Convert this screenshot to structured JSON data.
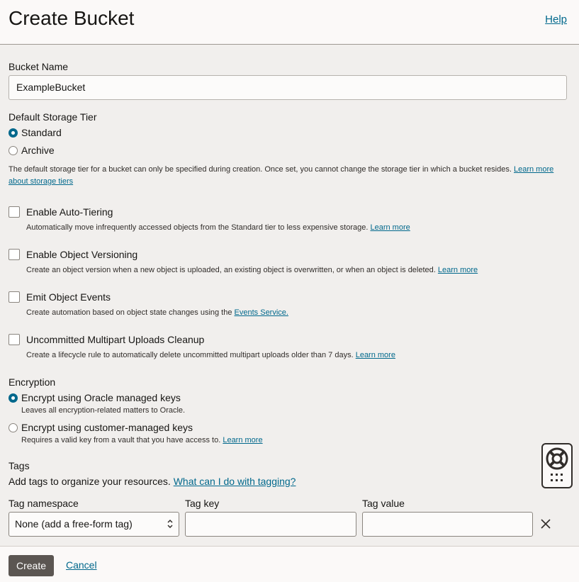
{
  "header": {
    "title": "Create Bucket",
    "help_link": "Help"
  },
  "bucket_name": {
    "label": "Bucket Name",
    "value": "ExampleBucket"
  },
  "storage_tier": {
    "label": "Default Storage Tier",
    "options": [
      "Standard",
      "Archive"
    ],
    "selected": "Standard",
    "help_text": "The default storage tier for a bucket can only be specified during creation. Once set, you cannot change the storage tier in which a bucket resides.",
    "learn_more": "Learn more about storage tiers",
    "learn_more_line1": "Learn more",
    "learn_more_line2": "about storage tiers"
  },
  "options": [
    {
      "label": "Enable Auto-Tiering",
      "description": "Automatically move infrequently accessed objects from the Standard tier to less expensive storage.",
      "link": "Learn more",
      "checked": false
    },
    {
      "label": "Enable Object Versioning",
      "description": "Create an object version when a new object is uploaded, an existing object is overwritten, or when an object is deleted.",
      "link": "Learn more",
      "checked": false
    },
    {
      "label": "Emit Object Events",
      "description": "Create automation based on object state changes using the",
      "link": "Events Service.",
      "checked": false
    },
    {
      "label": "Uncommitted Multipart Uploads Cleanup",
      "description": "Create a lifecycle rule to automatically delete uncommitted multipart uploads older than 7 days.",
      "link": "Learn more",
      "checked": false
    }
  ],
  "encryption": {
    "label": "Encryption",
    "options": [
      {
        "label": "Encrypt using Oracle managed keys",
        "description": "Leaves all encryption-related matters to Oracle.",
        "link": ""
      },
      {
        "label": "Encrypt using customer-managed keys",
        "description": "Requires a valid key from a vault that you have access to.",
        "link": "Learn more"
      }
    ],
    "selected": "Encrypt using Oracle managed keys"
  },
  "tags": {
    "label": "Tags",
    "intro": "Add tags to organize your resources.",
    "intro_link": "What can I do with tagging?",
    "namespace_label": "Tag namespace",
    "namespace_value": "None (add a free-form tag)",
    "key_label": "Tag key",
    "key_value": "",
    "value_label": "Tag value",
    "value_value": ""
  },
  "footer": {
    "create_label": "Create",
    "cancel_label": "Cancel"
  },
  "icons": {
    "help_widget": "lifebuoy-icon",
    "apps": "grid-dots-icon",
    "remove_tag": "close-icon"
  },
  "colors": {
    "accent": "#00688c",
    "create_button": "#5b5652",
    "background": "#f1efed"
  }
}
